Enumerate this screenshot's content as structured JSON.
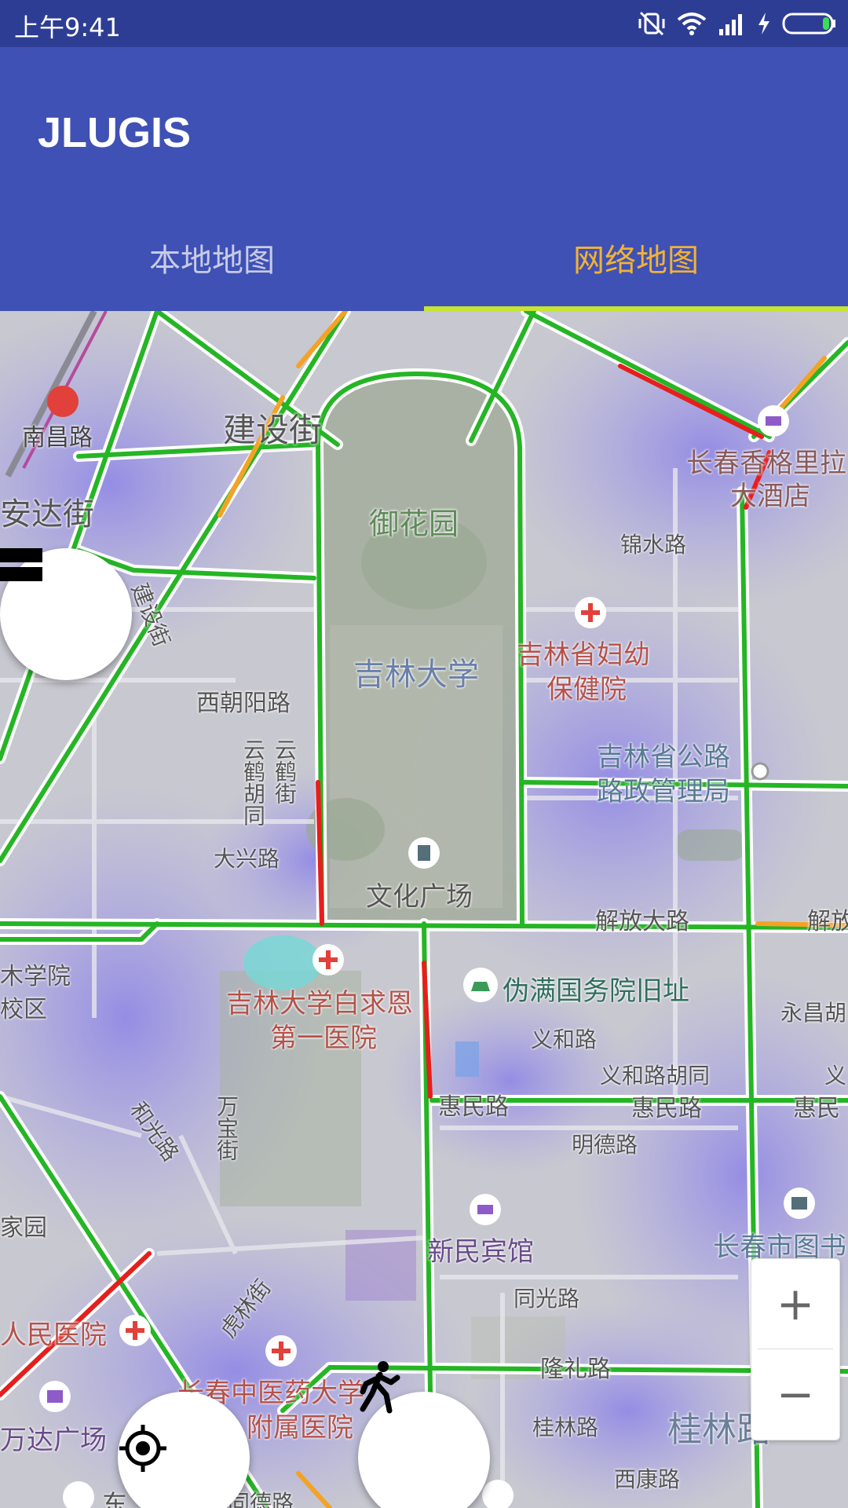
{
  "status_bar": {
    "time": "上午9:41",
    "icons": [
      "vibrate-off-icon",
      "wifi-icon",
      "signal-icon",
      "charging-icon",
      "battery-icon"
    ]
  },
  "app_bar": {
    "title": "JLUGIS"
  },
  "tabs": [
    {
      "label": "本地地图",
      "active": false
    },
    {
      "label": "网络地图",
      "active": true
    }
  ],
  "colors": {
    "primary": "#3f51b5",
    "status_bar": "#2e3d94",
    "tab_active_text": "#f2b233",
    "tab_indicator": "#c6e52f",
    "traffic_smooth": "#25b525",
    "traffic_slow": "#f4a226",
    "traffic_jam": "#e81d1d",
    "poi_label": "#b5524a",
    "place_label": "#2f6f5e"
  },
  "map": {
    "labels": {
      "nanchang_road": "南昌路",
      "jianshe_street": "建设街",
      "anda_street": "安达街",
      "yuhuayuan": "御花园",
      "jinshui_road": "锦水路",
      "shangri_la_1": "长春香格里拉",
      "shangri_la_2": "大酒店",
      "maternity_1": "吉林省妇幼",
      "maternity_2": "保健院",
      "jilin_university": "吉林大学",
      "xichaoyang_road": "西朝阳路",
      "jianshe_street_vertical": "建设街",
      "yunhe_hutong": "云鹤胡同",
      "yunhe_street": "云鹤街",
      "highway_bureau_1": "吉林省公路",
      "highway_bureau_2": "路政管理局",
      "daxing_road": "大兴路",
      "culture_square": "文化广场",
      "jiefang_road": "解放大路",
      "jiefang_road_right": "解放",
      "college_1": "木学院",
      "college_2": "校区",
      "bethune_hospital_1": "吉林大学白求恩",
      "bethune_hospital_2": "第一医院",
      "puppet_council": "伪满国务院旧址",
      "yonghu": "永昌胡",
      "yihe_road": "义和路",
      "yihe_hutong": "义和路胡同",
      "yi_right": "义",
      "huimin_road_1": "惠民路",
      "huimin_road_2": "惠民路",
      "huimin_road_3": "惠民",
      "heguang_road": "和光路",
      "wanbao_street": "万宝街",
      "mingde_road": "明德路",
      "changchun_library": "长春市图书",
      "park_left": "家园",
      "xinmin_hotel": "新民宾馆",
      "tongguang_road": "同光路",
      "hulin_street": "虎林街",
      "peoples_hospital": "人民医院",
      "tcm_hospital_1": "长春中医药大学",
      "tcm_hospital_2": "附属医院",
      "longli_road": "隆礼路",
      "wanda_plaza": "万达广场",
      "guilin_road": "桂林路",
      "guilin_big": "桂林路",
      "xikang_road": "西康路",
      "dong_bottom": "东",
      "tongde_road": "同德路"
    }
  },
  "controls": {
    "layers_icon": "layers-icon",
    "locate_icon": "my-location-icon",
    "walk_icon": "walk-icon",
    "zoom_in": "+",
    "zoom_out": "−"
  }
}
